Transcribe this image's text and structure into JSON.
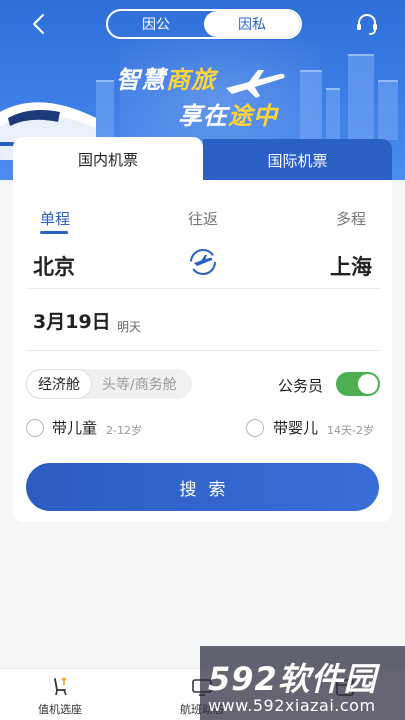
{
  "header": {
    "segment": [
      "因公",
      "因私"
    ],
    "slogan_line1_part1": "智慧",
    "slogan_line1_part2": "商旅",
    "slogan_line2_part1": "享在",
    "slogan_line2_part2": "途中"
  },
  "tabs": {
    "domestic": "国内机票",
    "international": "国际机票"
  },
  "trip_types": [
    "单程",
    "往返",
    "多程"
  ],
  "route": {
    "from": "北京",
    "to": "上海"
  },
  "date": {
    "main": "3月19日",
    "sub": "明天"
  },
  "cabin": {
    "economy": "经济舱",
    "business": "头等/商务舱"
  },
  "civil_servant": {
    "label": "公务员",
    "enabled": true
  },
  "options": [
    {
      "label": "带儿童",
      "sub": "2-12岁"
    },
    {
      "label": "带婴儿",
      "sub": "14天-2岁"
    }
  ],
  "search_label": "搜索",
  "bottom_nav": [
    {
      "label": "值机选座",
      "icon": "seat-icon"
    },
    {
      "label": "航班动态",
      "icon": "monitor-icon"
    },
    {
      "label": "",
      "icon": "calendar-icon"
    }
  ],
  "watermark": {
    "brand": "592软件园",
    "url": "www.592xiazai.com"
  },
  "colors": {
    "primary": "#2a5fc4",
    "accent": "#ffd43b",
    "toggle": "#4caf50"
  }
}
